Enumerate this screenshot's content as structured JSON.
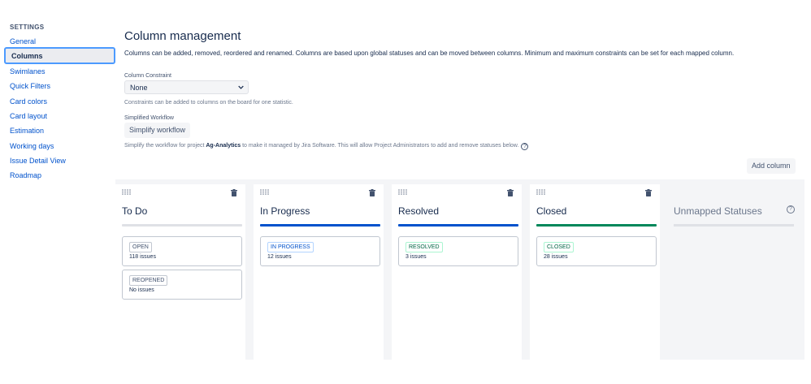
{
  "sidebar": {
    "heading": "SETTINGS",
    "items": [
      {
        "label": "General"
      },
      {
        "label": "Columns"
      },
      {
        "label": "Swimlanes"
      },
      {
        "label": "Quick Filters"
      },
      {
        "label": "Card colors"
      },
      {
        "label": "Card layout"
      },
      {
        "label": "Estimation"
      },
      {
        "label": "Working days"
      },
      {
        "label": "Issue Detail View"
      },
      {
        "label": "Roadmap"
      }
    ],
    "active": "Columns"
  },
  "header": {
    "title": "Column management",
    "description": "Columns can be added, removed, reordered and renamed. Columns are based upon global statuses and can be moved between columns. Minimum and maximum constraints can be set for each mapped column."
  },
  "constraint": {
    "label": "Column Constraint",
    "selected": "None",
    "help": "Constraints can be added to columns on the board for one statistic."
  },
  "workflow": {
    "label": "Simplified Workflow",
    "button": "Simplify workflow",
    "help_prefix": "Simplify the workflow for project ",
    "project": "Ag-Analytics",
    "help_suffix": " to make it managed by Jira Software. This will allow Project Administrators to add and remove statuses below.",
    "help_icon": "?"
  },
  "add_column_label": "Add column",
  "columns": [
    {
      "title": "To Do",
      "rule_color": "#dfe1e6",
      "statuses": [
        {
          "name": "OPEN",
          "count": "118 issues"
        },
        {
          "name": "REOPENED",
          "count": "No issues"
        }
      ]
    },
    {
      "title": "In Progress",
      "rule_color": "#0052cc",
      "statuses": [
        {
          "name": "IN PROGRESS",
          "count": "12 issues"
        }
      ]
    },
    {
      "title": "Resolved",
      "rule_color": "#0052cc",
      "statuses": [
        {
          "name": "RESOLVED",
          "count": "3 issues"
        }
      ]
    },
    {
      "title": "Closed",
      "rule_color": "#00875a",
      "statuses": [
        {
          "name": "CLOSED",
          "count": "28 issues"
        }
      ]
    }
  ],
  "unmapped": {
    "title": "Unmapped Statuses",
    "help_icon": "?"
  },
  "colors": {
    "todo_lozenge": "#42526e",
    "progress_lozenge": "#0052cc",
    "done_lozenge": "#006644"
  }
}
